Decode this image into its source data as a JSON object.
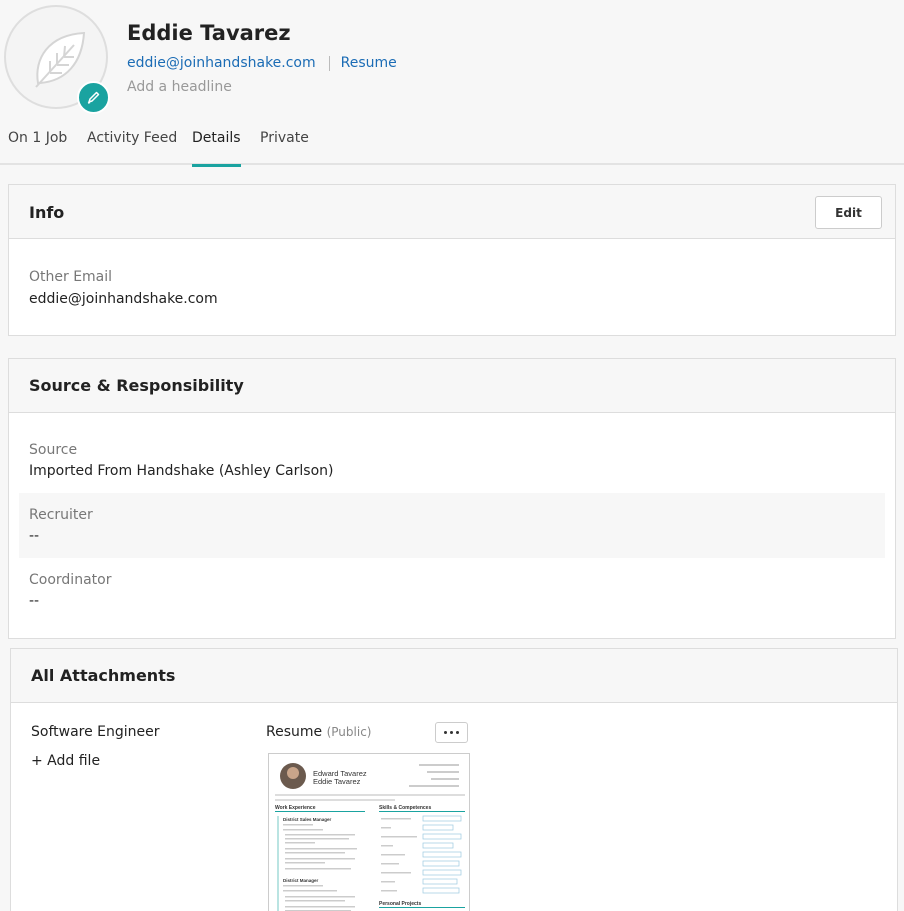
{
  "profile": {
    "name": "Eddie Tavarez",
    "email": "eddie@joinhandshake.com",
    "resume_link": "Resume",
    "headline_placeholder": "Add a headline"
  },
  "tabs": [
    {
      "label": "On 1 Job"
    },
    {
      "label": "Activity Feed"
    },
    {
      "label": "Details",
      "active": true
    },
    {
      "label": "Private"
    }
  ],
  "info": {
    "title": "Info",
    "edit_label": "Edit",
    "other_email_label": "Other Email",
    "other_email_value": "eddie@joinhandshake.com"
  },
  "source": {
    "title": "Source & Responsibility",
    "source_label": "Source",
    "source_value": "Imported From Handshake (Ashley Carlson)",
    "recruiter_label": "Recruiter",
    "recruiter_value": "--",
    "coordinator_label": "Coordinator",
    "coordinator_value": "--"
  },
  "attachments": {
    "title": "All Attachments",
    "job_name": "Software Engineer",
    "add_file": "+ Add file",
    "file_name": "Resume",
    "file_visibility": "(Public)",
    "thumbnail": {
      "name_line1": "Edward Tavarez",
      "name_line2": "Eddie Tavarez",
      "section_left": "Work Experience",
      "section_right": "Skills & Competences",
      "section_right2": "Personal Projects",
      "job1": "District Sales Manager",
      "job2": "District Manager"
    }
  },
  "colors": {
    "accent": "#1aa3a0",
    "link": "#1b6cb5"
  }
}
